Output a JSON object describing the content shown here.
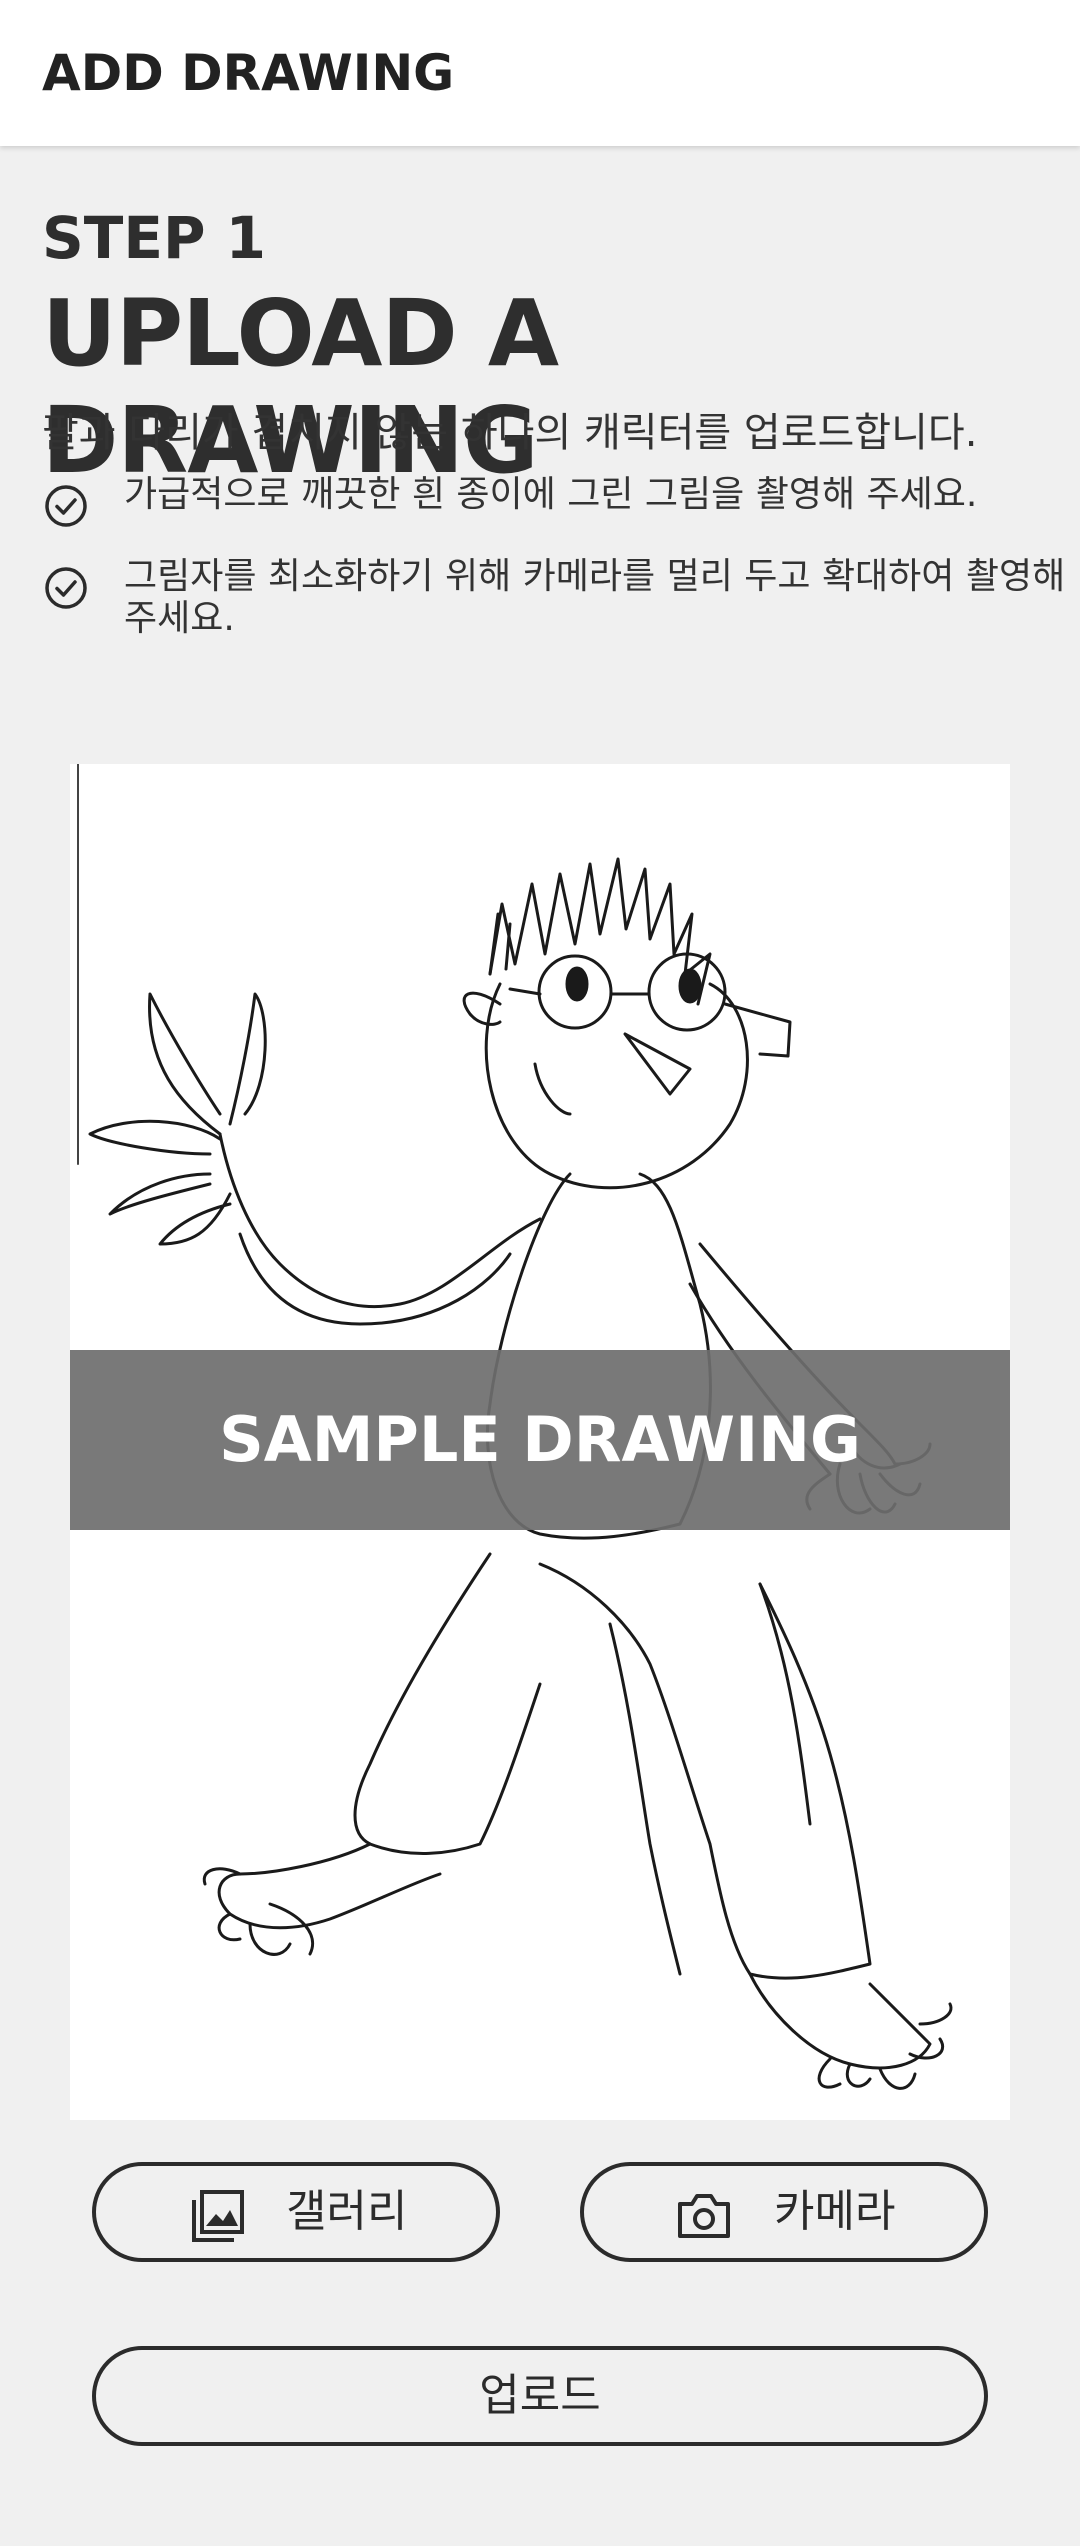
{
  "app_bar": {
    "title": "ADD DRAWING"
  },
  "step": {
    "label": "STEP 1",
    "heading": "UPLOAD A DRAWING",
    "intro": "팔과 다리가 겹치지 않는 하나의 캐릭터를 업로드합니다.",
    "tips": [
      {
        "icon": "check-circle-icon",
        "text": "가급적으로 깨끗한 흰 종이에 그린 그림을 촬영해 주세요."
      },
      {
        "icon": "check-circle-icon",
        "text": "그림자를 최소화하기 위해 카메라를 멀리 두고 확대하여 촬영해 주세요."
      }
    ]
  },
  "sample": {
    "banner_text": "SAMPLE DRAWING"
  },
  "buttons": {
    "gallery": {
      "label": "갤러리",
      "icon": "gallery-icon"
    },
    "camera": {
      "label": "카메라",
      "icon": "camera-icon"
    },
    "upload": {
      "label": "업로드"
    }
  },
  "colors": {
    "background": "#f0f0f0",
    "app_bar": "#ffffff",
    "text": "#2b2b2b",
    "banner": "#6e6e6e"
  }
}
